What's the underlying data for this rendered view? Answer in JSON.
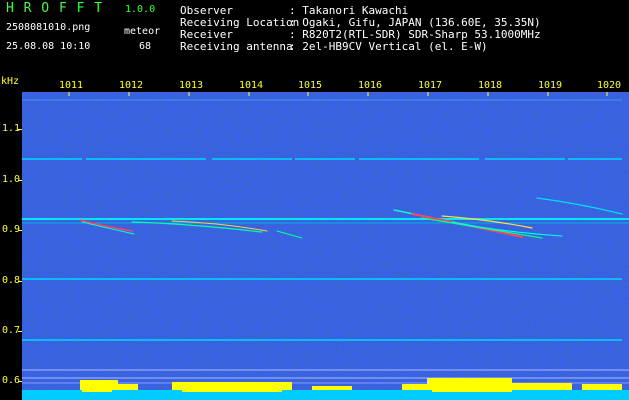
{
  "app": {
    "name": "H R O F F T",
    "version": "1.0.0"
  },
  "file": {
    "name": "2508081010.png",
    "timestamp": "25.08.08 10:10"
  },
  "counter": {
    "label": "meteor",
    "value": "68"
  },
  "info": [
    {
      "label": "Observer",
      "value": ": Takanori Kawachi"
    },
    {
      "label": "Receiving Location",
      "value": ": Ogaki, Gifu, JAPAN (136.60E, 35.35N)"
    },
    {
      "label": "Receiver",
      "value": ": R820T2(RTL-SDR) SDR-Sharp 53.1000MHz"
    },
    {
      "label": "Receiving antenna",
      "value": ": 2el-HB9CV Vertical (el. E-W)"
    }
  ],
  "axis": {
    "y_unit": "kHz",
    "y_ticks": [
      "1.1",
      "1.0",
      "0.9",
      "0.8",
      "0.7",
      "0.6"
    ],
    "x_ticks": [
      "1011",
      "1012",
      "1013",
      "1014",
      "1015",
      "1016",
      "1017",
      "1018",
      "1019",
      "1020"
    ]
  },
  "colors": {
    "background": "#0a1aa0",
    "signal": "#00e0ff",
    "meteor": "#ff4060",
    "level": "#ffff00",
    "baseline": "#00ccff"
  }
}
